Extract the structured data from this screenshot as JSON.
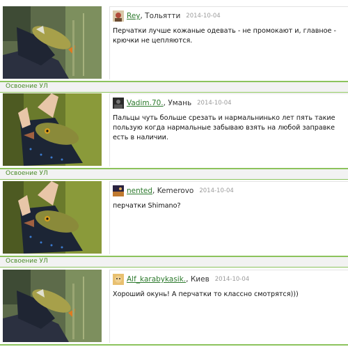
{
  "feed": {
    "entries": [
      {
        "author": "Rey",
        "place": ", Тольятти",
        "date": "2014-10-04",
        "text": "Перчатки лучше кожаные одевать - не промокают и, главное - крючки не цепляются.",
        "tag": "Освоение УЛ"
      },
      {
        "author": "Vadim.70.",
        "place": ", Умань",
        "date": "2014-10-04",
        "text": "Пальцы чуть больше срезать и нармальнинько лет пять такие пользую когда нармальные забываю взять на любой заправке есть в наличии.",
        "tag": "Освоение УЛ"
      },
      {
        "author": "nented",
        "place": ", Kemerovo",
        "date": "2014-10-04",
        "text": "перчатки Shimano?",
        "tag": "Освоение УЛ"
      },
      {
        "author": "Alf_karabykasik.",
        "place": ", Киев",
        "date": "2014-10-04",
        "text": "Хороший окунь! А перчатки то классно смотрятся)))"
      }
    ]
  }
}
